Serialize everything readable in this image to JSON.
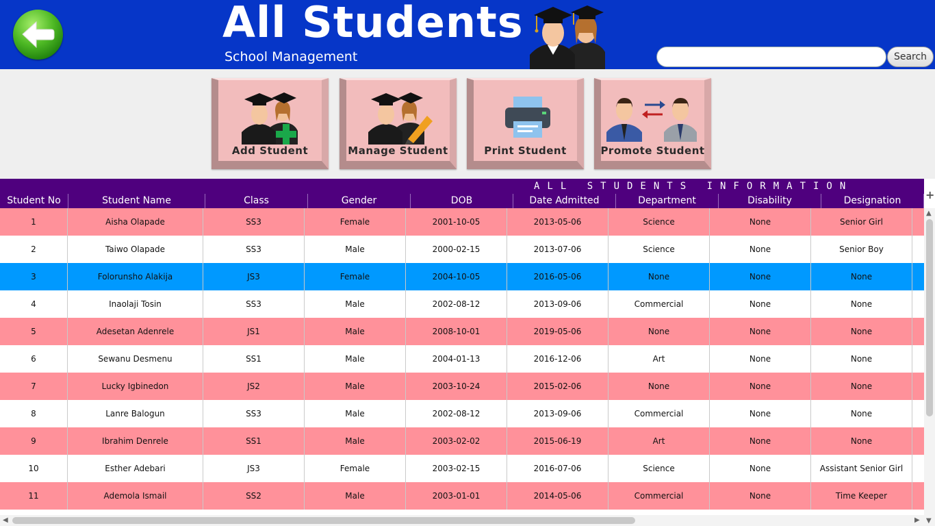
{
  "header": {
    "title": "All Students",
    "subtitle": "School Management",
    "background": "#0636c8",
    "search_value": "",
    "search_button": "Search"
  },
  "actions": [
    {
      "label": "Add Student",
      "icon": "students-add-icon"
    },
    {
      "label": "Manage Student",
      "icon": "students-edit-icon"
    },
    {
      "label": "Print Student",
      "icon": "printer-icon"
    },
    {
      "label": "Promote Student",
      "icon": "promote-icon"
    }
  ],
  "table": {
    "banner": "ALL STUDENTS INFORMATION",
    "columns": [
      "Student No",
      "Student Name",
      "Class",
      "Gender",
      "DOB",
      "Date Admitted",
      "Department",
      "Disability",
      "Designation"
    ],
    "selected_row": 2,
    "rows": [
      [
        "1",
        "Aisha Olapade",
        "SS3",
        "Female",
        "2001-10-05",
        "2013-05-06",
        "Science",
        "None",
        "Senior Girl"
      ],
      [
        "2",
        "Taiwo Olapade",
        "SS3",
        "Male",
        "2000-02-15",
        "2013-07-06",
        "Science",
        "None",
        "Senior Boy"
      ],
      [
        "3",
        "Folorunsho Alakija",
        "JS3",
        "Female",
        "2004-10-05",
        "2016-05-06",
        "None",
        "None",
        "None"
      ],
      [
        "4",
        "Inaolaji Tosin",
        "SS3",
        "Male",
        "2002-08-12",
        "2013-09-06",
        "Commercial",
        "None",
        "None"
      ],
      [
        "5",
        "Adesetan Adenrele",
        "JS1",
        "Male",
        "2008-10-01",
        "2019-05-06",
        "None",
        "None",
        "None"
      ],
      [
        "6",
        "Sewanu Desmenu",
        "SS1",
        "Male",
        "2004-01-13",
        "2016-12-06",
        "Art",
        "None",
        "None"
      ],
      [
        "7",
        "Lucky Igbinedon",
        "JS2",
        "Male",
        "2003-10-24",
        "2015-02-06",
        "None",
        "None",
        "None"
      ],
      [
        "8",
        "Lanre Balogun",
        "SS3",
        "Male",
        "2002-08-12",
        "2013-09-06",
        "Commercial",
        "None",
        "None"
      ],
      [
        "9",
        "Ibrahim Denrele",
        "SS1",
        "Male",
        "2003-02-02",
        "2015-06-19",
        "Art",
        "None",
        "None"
      ],
      [
        "10",
        "Esther Adebari",
        "JS3",
        "Female",
        "2003-02-15",
        "2016-07-06",
        "Science",
        "None",
        "Assistant Senior Girl"
      ],
      [
        "11",
        "Ademola Ismail",
        "SS2",
        "Male",
        "2003-01-01",
        "2014-05-06",
        "Commercial",
        "None",
        "Time Keeper"
      ]
    ]
  },
  "colors": {
    "table_header": "#4f007e",
    "row_odd": "#ff919a",
    "row_even": "#ffffff",
    "row_selected": "#0099ff",
    "action_button": "#f2bcbc"
  }
}
